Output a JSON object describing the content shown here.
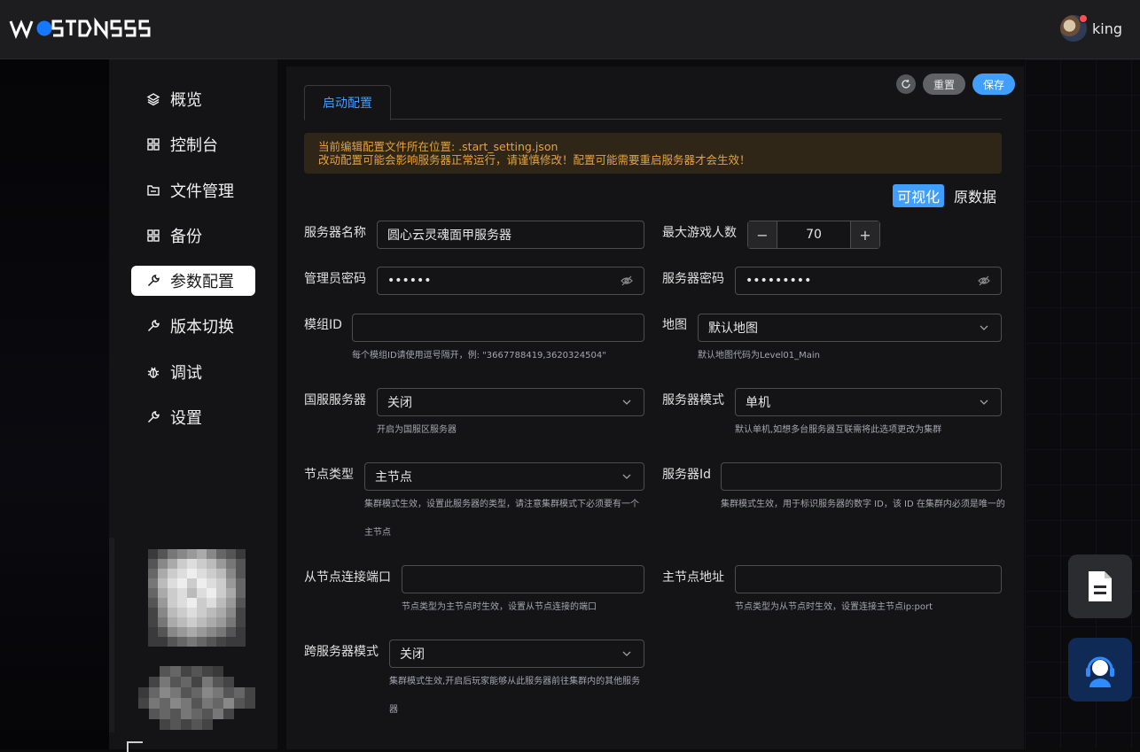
{
  "header": {
    "logo_text": "WOSTDNSS",
    "username": "king"
  },
  "sidebar": {
    "items": [
      {
        "label": "概览",
        "icon": "layers-icon"
      },
      {
        "label": "控制台",
        "icon": "grid-icon"
      },
      {
        "label": "文件管理",
        "icon": "folder-icon"
      },
      {
        "label": "备份",
        "icon": "grid-icon"
      },
      {
        "label": "参数配置",
        "icon": "wrench-icon",
        "active": true
      },
      {
        "label": "版本切换",
        "icon": "wrench-icon"
      },
      {
        "label": "调试",
        "icon": "bug-icon"
      },
      {
        "label": "设置",
        "icon": "wrench-icon"
      }
    ]
  },
  "toolbar": {
    "reset_label": "重置",
    "save_label": "保存"
  },
  "tabs": [
    {
      "label": "启动配置"
    }
  ],
  "alert": {
    "line1": "当前编辑配置文件所在位置: .start_setting.json",
    "line2": "改动配置可能会影响服务器正常运行，请谨慎修改！配置可能需要重启服务器才会生效！"
  },
  "mode_switch": {
    "visual": "可视化",
    "raw": "原数据"
  },
  "form": {
    "server_name": {
      "label": "服务器名称",
      "value": "圆心云灵魂面甲服务器"
    },
    "max_players": {
      "label": "最大游戏人数",
      "value": "70"
    },
    "admin_password": {
      "label": "管理员密码",
      "value": "••••••"
    },
    "server_password": {
      "label": "服务器密码",
      "value": "•••••••••"
    },
    "mod_id": {
      "label": "模组ID",
      "value": "",
      "hint": "每个模组ID请使用逗号隔开，例: \"3667788419,3620324504\""
    },
    "map": {
      "label": "地图",
      "value": "默认地图",
      "hint": "默认地图代码为Level01_Main"
    },
    "cn_server": {
      "label": "国服服务器",
      "value": "关闭",
      "hint": "开启为国服区服务器"
    },
    "server_mode": {
      "label": "服务器模式",
      "value": "单机",
      "hint": "默认单机,如想多台服务器互联需将此选项更改为集群"
    },
    "node_type": {
      "label": "节点类型",
      "value": "主节点",
      "hint_line1": "集群模式生效，设置此服务器的类型，请注意集群模式下必须要有一个",
      "hint_line2": "主节点"
    },
    "server_id": {
      "label": "服务器Id",
      "value": "",
      "hint": "集群模式生效，用于标识服务器的数字 ID，该 ID 在集群内必须是唯一的"
    },
    "slave_port": {
      "label": "从节点连接端口",
      "value": "",
      "hint": "节点类型为主节点时生效，设置从节点连接的端口"
    },
    "master_addr": {
      "label": "主节点地址",
      "value": "",
      "hint": "节点类型为从节点时生效，设置连接主节点ip:port"
    },
    "cross_server": {
      "label": "跨服务器模式",
      "value": "关闭",
      "hint_line1": "集群模式生效,开启后玩家能够从此服务器前往集群内的其他服务",
      "hint_line2": "器"
    }
  },
  "colors": {
    "accent": "#409eff",
    "warning": "#e6a23c"
  }
}
